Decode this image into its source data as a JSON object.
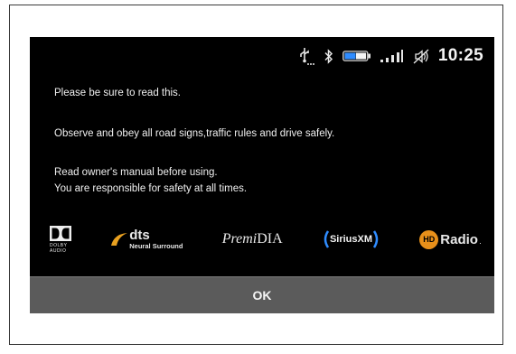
{
  "status": {
    "time": "10:25",
    "icons": [
      "usb-icon",
      "bluetooth-icon",
      "battery-icon",
      "signal-icon",
      "mute-icon"
    ],
    "battery_color": "#2f8cff"
  },
  "message": {
    "line1": "Please be sure to read this.",
    "line2": "Observe and obey all road signs,traffic rules and drive safely.",
    "line3": "Read owner's manual before using.",
    "line4": "You are responsible for safety at all times."
  },
  "logos": {
    "dolby_top": "DOLBY",
    "dolby_bottom": "AUDIO",
    "dts_name": "dts",
    "dts_sub": "Neural Surround",
    "premidia_a": "Premi",
    "premidia_b": "DIA",
    "siriusxm": "SiriusXM",
    "hd_letters": "HD",
    "hd_radio": "Radio",
    "hd_mark": "·"
  },
  "button": {
    "ok_label": "OK"
  }
}
